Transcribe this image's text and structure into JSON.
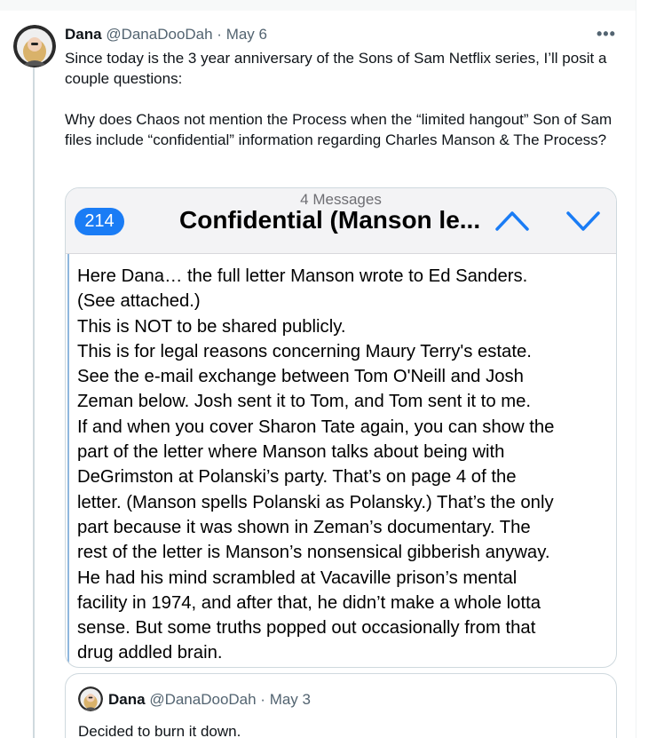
{
  "tweet": {
    "author_name": "Dana",
    "author_meta": "@DanaDooDah · May 6",
    "more_icon": "•••",
    "paragraphs": [
      "Since today is the 3 year anniversary of the Sons of Sam Netflix series, I’ll posit a couple questions:",
      "Why does Chaos not mention the Process when the “limited hangout” Son of Sam files include “confidential” information regarding Charles Manson & The Process?"
    ]
  },
  "email_card": {
    "message_count": "4 Messages",
    "badge": "214",
    "subject": "Confidential (Manson le...",
    "body_lines": [
      "Here Dana… the full letter Manson wrote to Ed Sanders.",
      "(See attached.)",
      "This is NOT to be shared publicly.",
      "This is for legal reasons concerning Maury Terry's estate.",
      "See the e-mail exchange between Tom O'Neill and Josh",
      "Zeman below. Josh sent it to Tom, and Tom sent it to me.",
      "If and when you cover Sharon Tate again, you can show the",
      "part of the letter where Manson talks about being with",
      "DeGrimston at Polanski’s party. That’s on page 4 of the",
      "letter. (Manson spells Polanski as Polansky.) That’s the only",
      "part because it was shown in Zeman’s documentary. The",
      "rest of the letter is Manson’s nonsensical gibberish anyway.",
      "He had his mind scrambled at Vacaville prison’s mental",
      "facility in 1974, and after that, he didn’t make a whole lotta",
      "sense. But some truths popped out occasionally from that",
      "drug addled brain."
    ],
    "accent_color": "#1a7cf5"
  },
  "quoted_tweet": {
    "author_name": "Dana",
    "author_meta": "@DanaDooDah · May 3",
    "text": "Decided to burn it down."
  }
}
